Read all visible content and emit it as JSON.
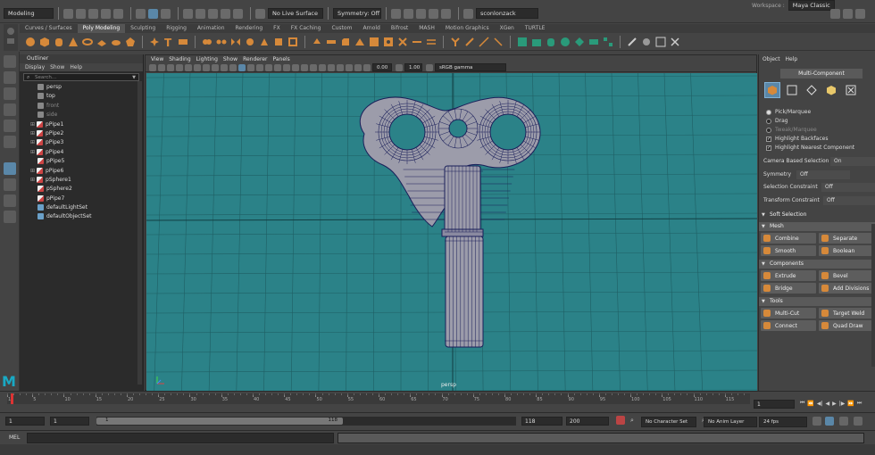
{
  "status_line": {
    "menu_set": "Modeling",
    "live_surface": "No Live Surface",
    "symmetry": "Symmetry: Off",
    "user": "sconlonzack",
    "workspace_label": "Workspace :",
    "workspace_value": "Maya Classic"
  },
  "shelf_tabs": [
    "Curves / Surfaces",
    "Poly Modeling",
    "Sculpting",
    "Rigging",
    "Animation",
    "Rendering",
    "FX",
    "FX Caching",
    "Custom",
    "Arnold",
    "Bifrost",
    "MASH",
    "Motion Graphics",
    "XGen",
    "TURTLE"
  ],
  "shelf_active": "Poly Modeling",
  "outliner": {
    "title": "Outliner",
    "menu": [
      "Display",
      "Show",
      "Help"
    ],
    "search_placeholder": "Search...",
    "items": [
      {
        "label": "persp",
        "kind": "camera",
        "dim": false,
        "expand": false
      },
      {
        "label": "top",
        "kind": "camera",
        "dim": false,
        "expand": false
      },
      {
        "label": "front",
        "kind": "camera",
        "dim": true,
        "expand": false
      },
      {
        "label": "side",
        "kind": "camera",
        "dim": true,
        "expand": false
      },
      {
        "label": "pPipe1",
        "kind": "mesh",
        "dim": false,
        "expand": true
      },
      {
        "label": "pPipe2",
        "kind": "mesh",
        "dim": false,
        "expand": true
      },
      {
        "label": "pPipe3",
        "kind": "mesh",
        "dim": false,
        "expand": true
      },
      {
        "label": "pPipe4",
        "kind": "mesh",
        "dim": false,
        "expand": true
      },
      {
        "label": "pPipe5",
        "kind": "mesh",
        "dim": false,
        "expand": false
      },
      {
        "label": "pPipe6",
        "kind": "mesh",
        "dim": false,
        "expand": true
      },
      {
        "label": "pSphere1",
        "kind": "mesh",
        "dim": false,
        "expand": true
      },
      {
        "label": "pSphere2",
        "kind": "mesh",
        "dim": false,
        "expand": false
      },
      {
        "label": "pPipe7",
        "kind": "mesh",
        "dim": false,
        "expand": false
      },
      {
        "label": "defaultLightSet",
        "kind": "set",
        "dim": false,
        "expand": false
      },
      {
        "label": "defaultObjectSet",
        "kind": "set",
        "dim": false,
        "expand": false
      }
    ]
  },
  "viewport": {
    "menu": [
      "View",
      "Shading",
      "Lighting",
      "Show",
      "Renderer",
      "Panels"
    ],
    "exposure": "0.00",
    "gamma": "1.00",
    "color_space": "sRGB gamma",
    "camera_label": "persp",
    "background_color": "#2b8288"
  },
  "right_panel": {
    "menu": [
      "Object",
      "Help"
    ],
    "mode_title": "Multi-Component",
    "options": [
      {
        "label": "Pick/Marquee",
        "type": "radio",
        "checked": true
      },
      {
        "label": "Drag",
        "type": "radio",
        "checked": false
      },
      {
        "label": "Tweak/Marquee",
        "type": "radio",
        "checked": false,
        "dim": true
      },
      {
        "label": "Highlight Backfaces",
        "type": "check",
        "checked": true
      },
      {
        "label": "Highlight Nearest Component",
        "type": "check",
        "checked": true
      }
    ],
    "settings": [
      {
        "label": "Camera Based Selection",
        "value": "On"
      },
      {
        "label": "Symmetry",
        "value": "Off"
      },
      {
        "label": "Selection Constraint",
        "value": "Off"
      },
      {
        "label": "Transform Constraint",
        "value": "Off"
      }
    ],
    "soft_selection": "Soft Selection",
    "sections": [
      {
        "title": "Mesh",
        "buttons": [
          "Combine",
          "Separate",
          "Smooth",
          "Boolean"
        ]
      },
      {
        "title": "Components",
        "buttons": [
          "Extrude",
          "Bevel",
          "Bridge",
          "Add Divisions"
        ]
      },
      {
        "title": "Tools",
        "buttons": [
          "Multi-Cut",
          "Target Weld",
          "Connect",
          "Quad Draw"
        ]
      }
    ]
  },
  "time_slider": {
    "ticks": [
      "1",
      "5",
      "10",
      "15",
      "20",
      "25",
      "30",
      "35",
      "40",
      "45",
      "50",
      "55",
      "60",
      "65",
      "70",
      "75",
      "80",
      "85",
      "90",
      "95",
      "100",
      "105",
      "110",
      "115"
    ],
    "current_frame": "1"
  },
  "range_slider": {
    "start": "1",
    "anim_start": "1",
    "range_start_label": "1",
    "range_end_label": "118",
    "anim_end": "118",
    "end": "200",
    "character_set": "No Character Set",
    "anim_layer": "No Anim Layer",
    "fps": "24 fps"
  },
  "command_line": {
    "lang": "MEL"
  },
  "accent_colors": {
    "maya_blue": "#19a9c4",
    "shelf_orange": "#d6893a",
    "mesh_fill": "#9c9caa",
    "wire": "#1a1f5a"
  }
}
